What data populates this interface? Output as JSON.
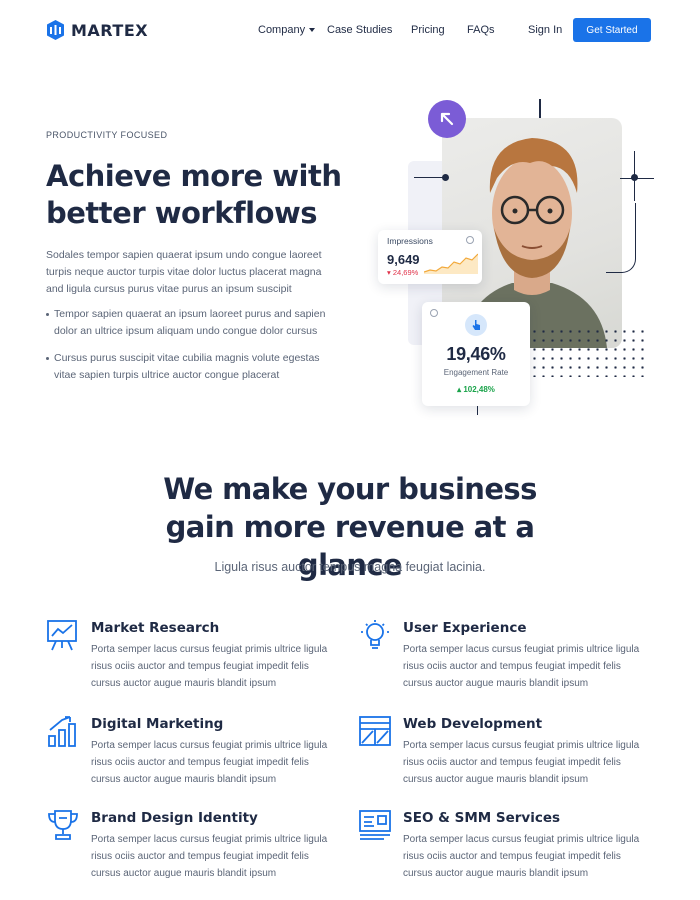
{
  "nav": {
    "brand": "MARTEX",
    "links": [
      "Company",
      "Case Studies",
      "Pricing",
      "FAQs"
    ],
    "signin": "Sign In",
    "cta": "Get Started"
  },
  "hero": {
    "eyebrow": "PRODUCTIVITY FOCUSED",
    "title": "Achieve more with better workflows",
    "description": "Sodales tempor sapien quaerat ipsum undo congue laoreet turpis neque auctor turpis vitae dolor luctus placerat magna and ligula cursus purus vitae purus an ipsum suscipit",
    "bullets": [
      "Tempor sapien quaerat an ipsum laoreet purus and sapien dolor an ultrice ipsum aliquam undo congue dolor cursus",
      "Cursus purus suscipit vitae cubilia magnis volute egestas vitae sapien turpis ultrice auctor congue placerat"
    ],
    "impressions": {
      "label": "Impressions",
      "value": "9,649",
      "change": "24,69%"
    },
    "engagement": {
      "value": "19,46%",
      "label": "Engagement Rate",
      "change": "102,48%"
    }
  },
  "section": {
    "title": "We make your business gain more revenue at a glance",
    "subtitle": "Ligula risus auctor tempus magna feugiat lacinia."
  },
  "features": [
    {
      "title": "Market Research",
      "icon": "presentation-chart-icon",
      "description": "Porta semper lacus cursus feugiat primis ultrice ligula risus ociis auctor and tempus feugiat impedit felis cursus auctor augue mauris blandit ipsum"
    },
    {
      "title": "User Experience",
      "icon": "lightbulb-icon",
      "description": "Porta semper lacus cursus feugiat primis ultrice ligula risus ociis auctor and tempus feugiat impedit felis cursus auctor augue mauris blandit ipsum"
    },
    {
      "title": "Digital Marketing",
      "icon": "growth-bars-icon",
      "description": "Porta semper lacus cursus feugiat primis ultrice ligula risus ociis auctor and tempus feugiat impedit felis cursus auctor augue mauris blandit ipsum"
    },
    {
      "title": "Web Development",
      "icon": "web-layout-icon",
      "description": "Porta semper lacus cursus feugiat primis ultrice ligula risus ociis auctor and tempus feugiat impedit felis cursus auctor augue mauris blandit ipsum"
    },
    {
      "title": "Brand Design Identity",
      "icon": "trophy-icon",
      "description": "Porta semper lacus cursus feugiat primis ultrice ligula risus ociis auctor and tempus feugiat impedit felis cursus auctor augue mauris blandit ipsum"
    },
    {
      "title": "SEO & SMM Services",
      "icon": "seo-screen-icon",
      "description": "Porta semper lacus cursus feugiat primis ultrice ligula risus ociis auctor and tempus feugiat impedit felis cursus auctor augue mauris blandit ipsum"
    }
  ],
  "colors": {
    "accent": "#1a73e8",
    "heading": "#1f2a44",
    "badge": "#7b5cd6",
    "positive": "#1aa34a",
    "negative": "#e0334a"
  }
}
